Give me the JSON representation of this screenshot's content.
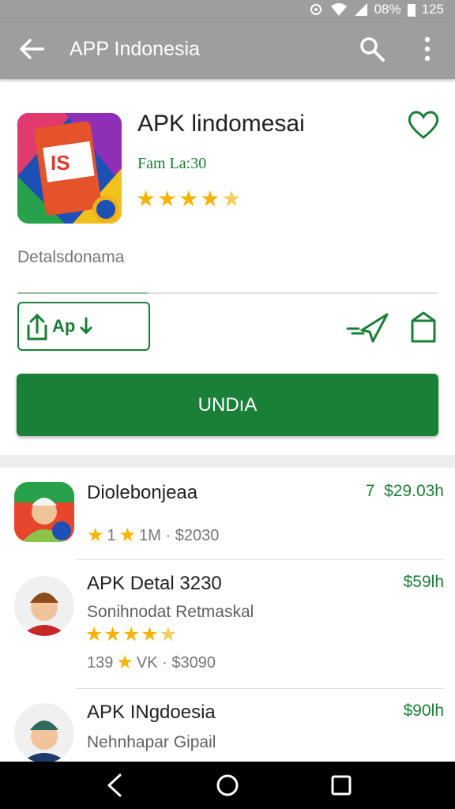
{
  "status_bar": {
    "battery_text": "08%",
    "time": "125"
  },
  "app_bar": {
    "title": "APP Indonesia",
    "back_icon": "arrow-back-icon",
    "search_icon": "search-icon",
    "menu_icon": "more-vert-icon"
  },
  "app": {
    "name": "APK lindomesai",
    "developer": "Fam La:30",
    "rating_stars": 4.5,
    "details_label": "Detalsdonama",
    "share_label": "Ap",
    "install_label": "UNDıA",
    "accent_color": "#1a7f37",
    "star_color": "#f6b300"
  },
  "related": [
    {
      "title": "Diolebonjeaa",
      "price": "$29.03h",
      "price_prefix": "7",
      "meta_count": "1",
      "meta_installs": "1M · $2030"
    },
    {
      "title": "APK Detal 3230",
      "subtitle": "Sonihnodat Retmaskal",
      "price": "$59lh",
      "rating_stars": 4.5,
      "meta_count": "139",
      "meta_installs": "VK · $3090"
    },
    {
      "title": "APK INgdoesia",
      "subtitle": "Nehnhapar Gipail",
      "price": "$90lh"
    }
  ],
  "nav": {
    "back_icon": "nav-back-icon",
    "home_icon": "nav-home-icon",
    "recents_icon": "nav-recents-icon"
  }
}
